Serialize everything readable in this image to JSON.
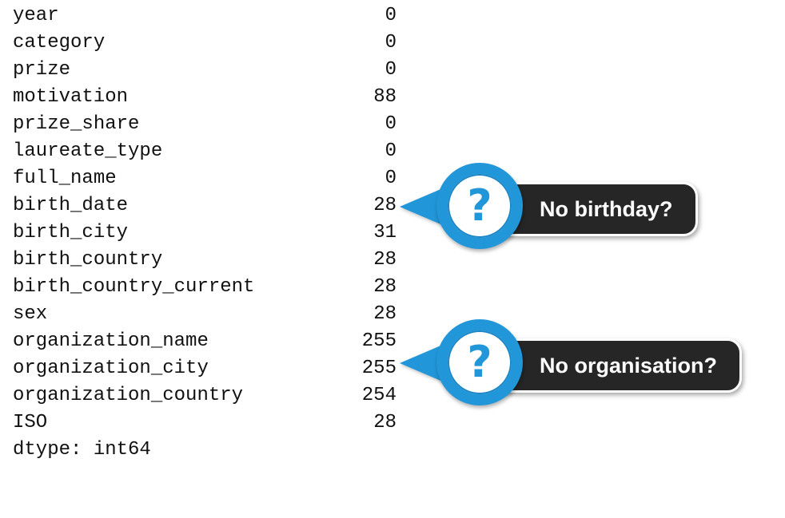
{
  "output": {
    "rows": [
      {
        "name": "year",
        "count": "0"
      },
      {
        "name": "category",
        "count": "0"
      },
      {
        "name": "prize",
        "count": "0"
      },
      {
        "name": "motivation",
        "count": "88"
      },
      {
        "name": "prize_share",
        "count": "0"
      },
      {
        "name": "laureate_type",
        "count": "0"
      },
      {
        "name": "full_name",
        "count": "0"
      },
      {
        "name": "birth_date",
        "count": "28"
      },
      {
        "name": "birth_city",
        "count": "31"
      },
      {
        "name": "birth_country",
        "count": "28"
      },
      {
        "name": "birth_country_current",
        "count": "28"
      },
      {
        "name": "sex",
        "count": "28"
      },
      {
        "name": "organization_name",
        "count": "255"
      },
      {
        "name": "organization_city",
        "count": "255"
      },
      {
        "name": "organization_country",
        "count": "254"
      },
      {
        "name": "ISO",
        "count": "28"
      }
    ],
    "dtype": "dtype: int64"
  },
  "callouts": [
    {
      "text": "No birthday?",
      "icon": "question-mark-icon",
      "glyph": "?"
    },
    {
      "text": "No organisation?",
      "icon": "question-mark-icon",
      "glyph": "?"
    }
  ],
  "colors": {
    "accent": "#2196d8",
    "pill": "#262626",
    "text": "#111111"
  }
}
